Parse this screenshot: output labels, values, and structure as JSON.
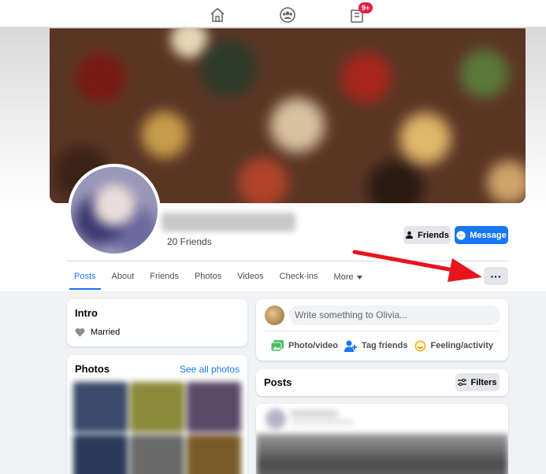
{
  "topnav": {
    "icons": [
      "home-icon",
      "groups-icon",
      "pages-icon"
    ],
    "notification_badge": "9+"
  },
  "profile": {
    "friends_count": "20 Friends",
    "buttons": {
      "friends": "Friends",
      "message": "Message",
      "more": "···"
    }
  },
  "tabs": [
    {
      "label": "Posts",
      "active": true
    },
    {
      "label": "About"
    },
    {
      "label": "Friends"
    },
    {
      "label": "Photos"
    },
    {
      "label": "Videos"
    },
    {
      "label": "Check-ins"
    },
    {
      "label": "More"
    }
  ],
  "intro": {
    "title": "Intro",
    "relationship": "Married"
  },
  "photos": {
    "title": "Photos",
    "see_all": "See all photos"
  },
  "composer": {
    "placeholder": "Write something to Olivia...",
    "actions": {
      "photo_video": "Photo/video",
      "tag_friends": "Tag friends",
      "feeling": "Feeling/activity"
    }
  },
  "posts": {
    "title": "Posts",
    "filters_label": "Filters"
  },
  "colors": {
    "accent": "#1877f2",
    "annotation_arrow": "#e8141c",
    "badge": "#e41e3f"
  }
}
